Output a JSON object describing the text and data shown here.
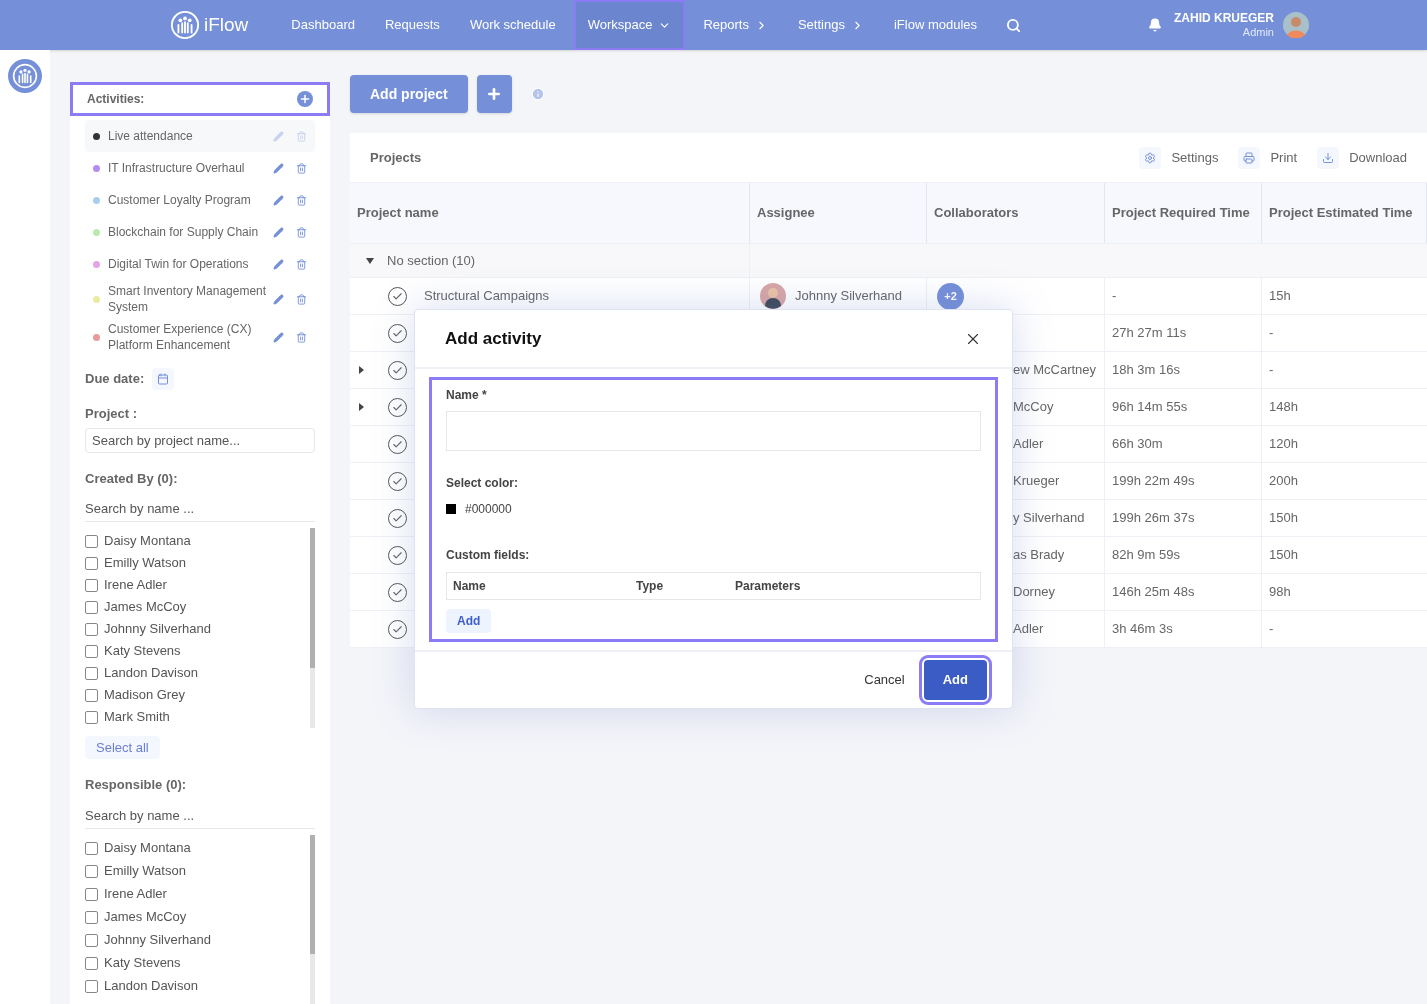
{
  "nav": {
    "logo": "iFlow",
    "items": [
      {
        "label": "Dashboard",
        "kind": "plain",
        "selected": false
      },
      {
        "label": "Requests",
        "kind": "plain",
        "selected": false
      },
      {
        "label": "Work schedule",
        "kind": "plain",
        "selected": false
      },
      {
        "label": "Workspace",
        "kind": "dropdown",
        "selected": true
      },
      {
        "label": "Reports",
        "kind": "submenu",
        "selected": false
      },
      {
        "label": "Settings",
        "kind": "submenu",
        "selected": false
      },
      {
        "label": "iFlow modules",
        "kind": "plain",
        "selected": false
      }
    ],
    "user": {
      "name": "ZAHID KRUEGER",
      "role": "Admin"
    }
  },
  "sidebar": {
    "activities": {
      "title": "Activities:",
      "highlighted": true,
      "items": [
        {
          "label": "Live attendance",
          "color": "#333333",
          "selected": true
        },
        {
          "label": "IT Infrastructure Overhaul",
          "color": "#b28cf0",
          "selected": false
        },
        {
          "label": "Customer Loyalty Program",
          "color": "#a8cdee",
          "selected": false
        },
        {
          "label": "Blockchain for Supply Chain",
          "color": "#b8eab0",
          "selected": false
        },
        {
          "label": "Digital Twin for Operations",
          "color": "#e6a3ea",
          "selected": false
        },
        {
          "label": "Smart Inventory Management System",
          "color": "#e8eba0",
          "selected": false
        },
        {
          "label": "Customer Experience (CX) Platform Enhancement",
          "color": "#e89a9a",
          "selected": false
        }
      ]
    },
    "due_date": "Due date:",
    "project": {
      "label": "Project :",
      "placeholder": "Search by project name..."
    },
    "created_by": {
      "label": "Created By (0):",
      "placeholder": "Search by name ...",
      "users": [
        {
          "name": "Daisy Montana",
          "checked": false
        },
        {
          "name": "Emilly Watson",
          "checked": false
        },
        {
          "name": "Irene Adler",
          "checked": false
        },
        {
          "name": "James McCoy",
          "checked": false
        },
        {
          "name": "Johnny Silverhand",
          "checked": false
        },
        {
          "name": "Katy Stevens",
          "checked": false
        },
        {
          "name": "Landon Davison",
          "checked": false
        },
        {
          "name": "Madison Grey",
          "checked": false
        },
        {
          "name": "Mark Smith",
          "checked": false
        }
      ],
      "select_all": "Select all"
    },
    "responsible": {
      "label": "Responsible (0):",
      "placeholder": "Search by name ...",
      "users": [
        {
          "name": "Daisy Montana",
          "checked": false
        },
        {
          "name": "Emilly Watson",
          "checked": false
        },
        {
          "name": "Irene Adler",
          "checked": false
        },
        {
          "name": "James McCoy",
          "checked": false
        },
        {
          "name": "Johnny Silverhand",
          "checked": false
        },
        {
          "name": "Katy Stevens",
          "checked": false
        },
        {
          "name": "Landon Davison",
          "checked": false
        }
      ]
    }
  },
  "toolbar": {
    "add_project": "Add project"
  },
  "projects": {
    "title": "Projects",
    "actions": [
      {
        "label": "Settings",
        "kind": "settings"
      },
      {
        "label": "Print",
        "kind": "print"
      },
      {
        "label": "Download",
        "kind": "download"
      }
    ],
    "columns": [
      "Project name",
      "Assignee",
      "Collaborators",
      "Project Required Time",
      "Project Estimated Time"
    ],
    "section": {
      "label": "No section (10)",
      "expanded": true
    },
    "rows": [
      {
        "name": "Structural Campaigns",
        "assignee": "Johnny Silverhand",
        "collaborators": "+2",
        "required": "-",
        "estimated": "15h",
        "expandable": false
      },
      {
        "required": "27h 27m 11s",
        "estimated": "-",
        "expandable": false
      },
      {
        "collaborators_partial": "ew McCartney",
        "required": "18h 3m 16s",
        "estimated": "-",
        "expandable": true
      },
      {
        "collaborators_partial": "McCoy",
        "required": "96h 14m 55s",
        "estimated": "148h",
        "expandable": true
      },
      {
        "collaborators_partial": "Adler",
        "required": "66h 30m",
        "estimated": "120h",
        "expandable": false
      },
      {
        "collaborators_partial": "Krueger",
        "required": "199h 22m 49s",
        "estimated": "200h",
        "expandable": false
      },
      {
        "collaborators_partial": "y Silverhand",
        "required": "199h 26m 37s",
        "estimated": "150h",
        "expandable": false
      },
      {
        "collaborators_partial": "as Brady",
        "required": "82h 9m 59s",
        "estimated": "150h",
        "expandable": false
      },
      {
        "collaborators_partial": "Dorney",
        "required": "146h 25m 48s",
        "estimated": "98h",
        "expandable": false
      },
      {
        "collaborators_partial": "Adler",
        "required": "3h 46m 3s",
        "estimated": "-",
        "expandable": false
      }
    ]
  },
  "modal": {
    "title": "Add activity",
    "body_highlighted": true,
    "name_label": "Name *",
    "color_label": "Select color:",
    "color": "#000000",
    "color_value": "#000000",
    "custom_label": "Custom fields:",
    "custom_columns": [
      "Name",
      "Type",
      "Parameters"
    ],
    "add_field": "Add",
    "cancel": "Cancel",
    "submit": "Add",
    "submit_highlighted": true
  }
}
